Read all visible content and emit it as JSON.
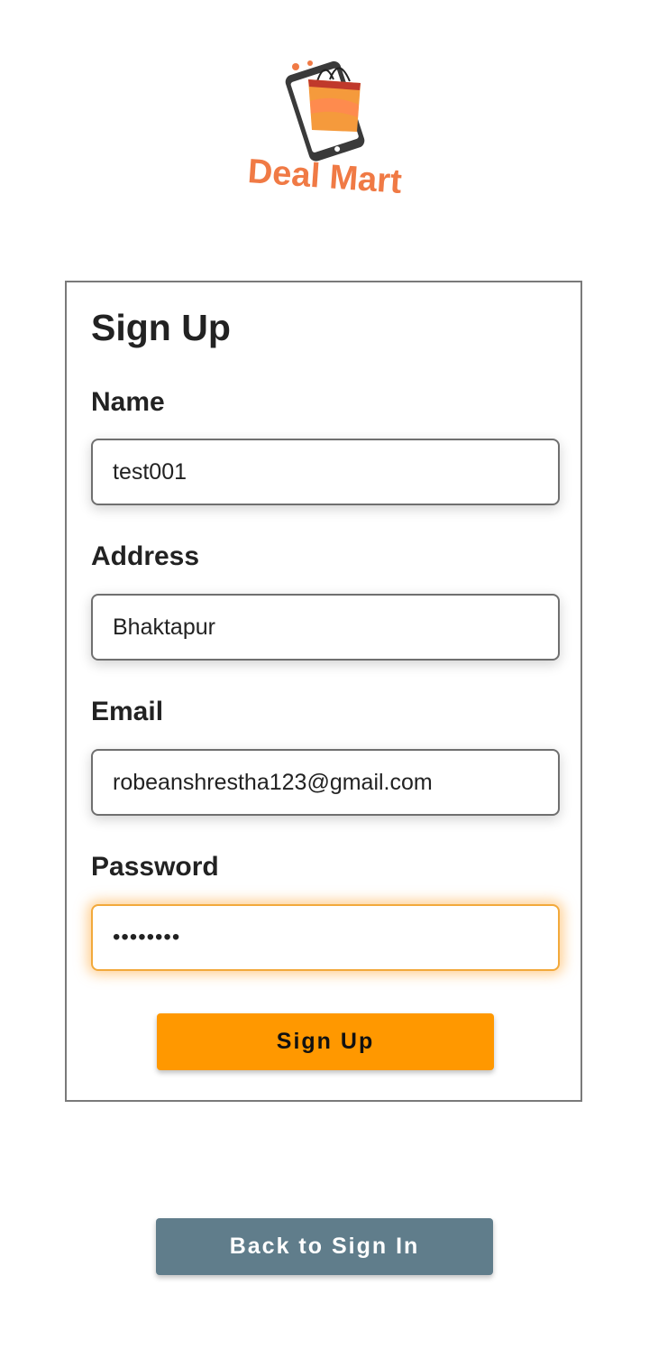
{
  "app": {
    "brand_name": "Deal Mart"
  },
  "form": {
    "title": "Sign Up",
    "fields": [
      {
        "label": "Name",
        "value": "test001"
      },
      {
        "label": "Address",
        "value": "Bhaktapur"
      },
      {
        "label": "Email",
        "value": "robeanshrestha123@gmail.com"
      },
      {
        "label": "Password",
        "value": "••••••••"
      }
    ],
    "submit_label": "Sign Up"
  },
  "footer": {
    "back_label": "Back to Sign In"
  },
  "colors": {
    "primary_button": "#ff9800",
    "secondary_button": "#607d8b",
    "brand_orange": "#f07a45",
    "focus_border": "#f2a93b"
  },
  "icons": {
    "logo": "phone-shopping-bag-icon"
  }
}
